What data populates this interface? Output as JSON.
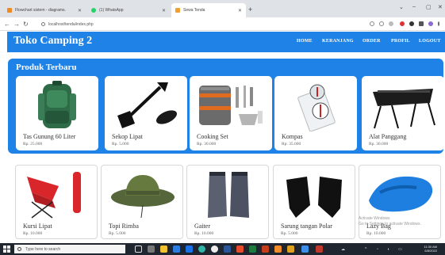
{
  "browser": {
    "tabs": [
      {
        "label": "Flowchart sistem - diagrams.net",
        "color": "#f08a24",
        "active": false
      },
      {
        "label": "(1) WhatsApp",
        "color": "#25d366",
        "active": false
      },
      {
        "label": "Sewa Tenda",
        "color": "#f0a030",
        "active": true
      }
    ],
    "url": "localhost/tenda/index.php"
  },
  "navbar": {
    "brand": "Toko Camping 2",
    "links": [
      "HOME",
      "KERANJANG",
      "ORDER",
      "PROFIL",
      "LOGOUT"
    ]
  },
  "featured": {
    "title": "Produk Terbaru",
    "products": [
      {
        "name": "Tas Gunung 60 Liter",
        "price": "Rp. 25.000"
      },
      {
        "name": "Sekop Lipat",
        "price": "Rp. 5.000"
      },
      {
        "name": "Cooking Set",
        "price": "Rp. 30.000"
      },
      {
        "name": "Kompas",
        "price": "Rp. 35.000"
      },
      {
        "name": "Alat Panggang",
        "price": "Rp. 30.000"
      }
    ]
  },
  "products_row2": [
    {
      "name": "Kursi Lipat",
      "price": "Rp. 10.000"
    },
    {
      "name": "Topi Rimba",
      "price": "Rp. 5.000"
    },
    {
      "name": "Gaiter",
      "price": "Rp. 10.000"
    },
    {
      "name": "Sarung tangan Polar",
      "price": "Rp. 5.000"
    },
    {
      "name": "Lazy Bag",
      "price": "Rp. 10.000"
    }
  ],
  "watermark": {
    "line1": "Activate Windows",
    "line2": "Go to Settings to activate Windows."
  },
  "taskbar": {
    "search_placeholder": "Type here to search",
    "time": "11:30 AM",
    "date": "6/8/2022"
  },
  "colors": {
    "brand_blue": "#1e82e6"
  }
}
